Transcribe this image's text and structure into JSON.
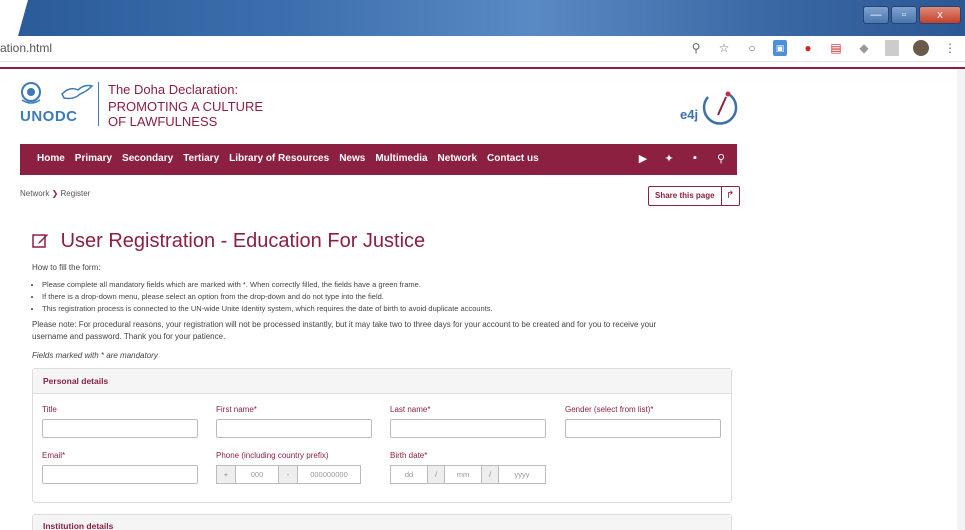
{
  "browser": {
    "url": "ation.html",
    "window_buttons": {
      "minimize": "—",
      "maximize": "▫",
      "close": "x"
    },
    "icons": [
      "search-icon",
      "star-icon",
      "extension-circle-icon",
      "extension-blue-icon",
      "extension-red-icon",
      "pdf-icon",
      "shield-icon",
      "avatar",
      "menu-icon"
    ]
  },
  "header": {
    "org_short": "UNODC",
    "doha_line1": "The Doha Declaration:",
    "doha_line2": "PROMOTING A CULTURE",
    "doha_line3": "OF LAWFULNESS",
    "e4j_text": "e4j"
  },
  "nav": {
    "items": [
      "Home",
      "Primary",
      "Secondary",
      "Tertiary",
      "Library of Resources",
      "News",
      "Multimedia",
      "Network",
      "Contact us"
    ],
    "social_icons": [
      "youtube-icon",
      "twitter-icon",
      "flickr-icon",
      "search-icon"
    ]
  },
  "breadcrumb": {
    "parent": "Network",
    "sep": "❯",
    "current": "Register"
  },
  "share": {
    "label": "Share this page",
    "icon": "↱"
  },
  "title": "User Registration - Education For Justice",
  "intro": {
    "howto": "How to fill the form:",
    "bullets": [
      "Please complete all mandatory fields which are marked with *. When correctly filled, the fields have a green frame.",
      "If there is a drop-down menu, please select an option from the drop-down and do not type into the field.",
      "This registration process is connected to the UN-wide Unite Identity system, which requires the date of birth to avoid duplicate accounts."
    ],
    "note_line1": "Please note: For procedural reasons, your registration will not be processed instantly, but it may take two to three days for your account to be created and for you to receive your",
    "note_line2": "username and password. Thank you for your patience.",
    "mandatory": "Fields marked with * are mandatory"
  },
  "personal": {
    "heading": "Personal details",
    "title_label": "Title",
    "first_label": "First name*",
    "last_label": "Last name*",
    "gender_label": "Gender (select from list)*",
    "email_label": "Email*",
    "phone_label": "Phone (including country prefix)",
    "phone_plus": "+",
    "phone_code": "000",
    "phone_dash": "-",
    "phone_number": "000000000",
    "birth_label": "Birth date*",
    "dd": "dd",
    "slash": "/",
    "mm": "mm",
    "yyyy": "yyyy"
  },
  "institution": {
    "heading": "Institution details"
  }
}
